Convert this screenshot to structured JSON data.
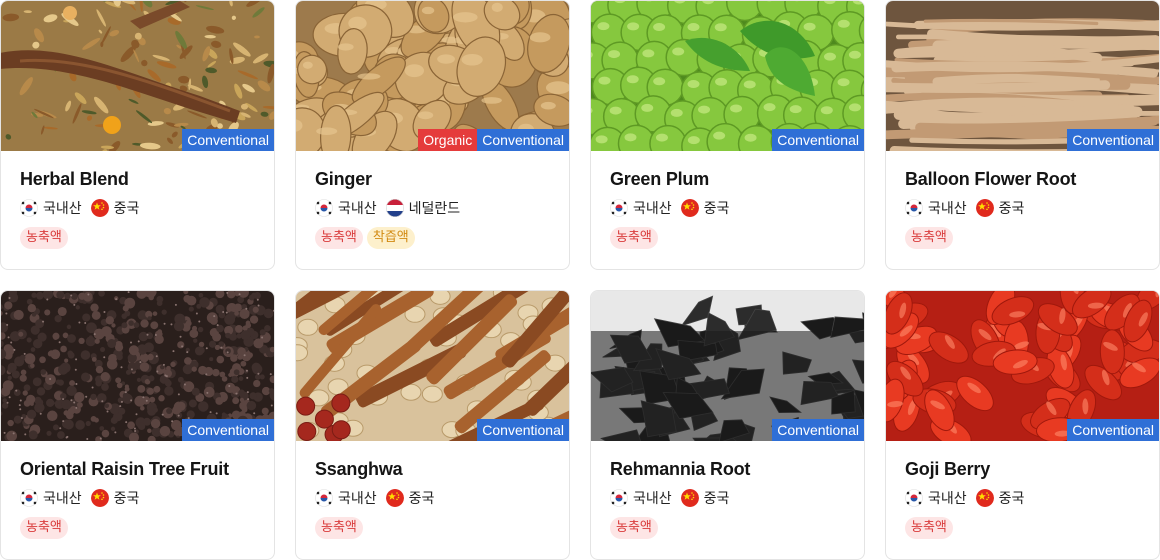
{
  "cards": [
    {
      "title": "Herbal Blend",
      "tags": [
        "Conventional"
      ],
      "origins": [
        "국내산",
        "중국"
      ],
      "badges": [
        "농축액"
      ],
      "image": "herbal-blend-photo",
      "colors": {
        "base": "#8a6a3a"
      }
    },
    {
      "title": "Ginger",
      "tags": [
        "Organic",
        "Conventional"
      ],
      "origins": [
        "국내산",
        "네덜란드"
      ],
      "badges": [
        "농축액",
        "착즙액"
      ],
      "image": "ginger-photo",
      "colors": {
        "base": "#c9a067"
      }
    },
    {
      "title": "Green Plum",
      "tags": [
        "Conventional"
      ],
      "origins": [
        "국내산",
        "중국"
      ],
      "badges": [
        "농축액"
      ],
      "image": "green-plum-photo",
      "colors": {
        "base": "#7ec23a"
      }
    },
    {
      "title": "Balloon Flower Root",
      "tags": [
        "Conventional"
      ],
      "origins": [
        "국내산",
        "중국"
      ],
      "badges": [
        "농축액"
      ],
      "image": "balloon-flower-root-photo",
      "colors": {
        "base": "#b89676"
      }
    },
    {
      "title": "Oriental Raisin Tree Fruit",
      "tags": [
        "Conventional"
      ],
      "origins": [
        "국내산",
        "중국"
      ],
      "badges": [
        "농축액"
      ],
      "image": "raisin-tree-fruit-photo",
      "colors": {
        "base": "#3e2f2c"
      }
    },
    {
      "title": "Ssanghwa",
      "tags": [
        "Conventional"
      ],
      "origins": [
        "국내산",
        "중국"
      ],
      "badges": [
        "농축액"
      ],
      "image": "ssanghwa-herbs-photo",
      "colors": {
        "base": "#a86a3a"
      }
    },
    {
      "title": "Rehmannia Root",
      "tags": [
        "Conventional"
      ],
      "origins": [
        "국내산",
        "중국"
      ],
      "badges": [
        "농축액"
      ],
      "image": "rehmannia-root-photo",
      "colors": {
        "base": "#1e1e1e"
      }
    },
    {
      "title": "Goji Berry",
      "tags": [
        "Conventional"
      ],
      "origins": [
        "국내산",
        "중국"
      ],
      "badges": [
        "농축액"
      ],
      "image": "goji-berry-photo",
      "colors": {
        "base": "#e0341f"
      }
    }
  ],
  "flag_icons": {
    "국내산": "korea-flag-icon",
    "중국": "china-flag-icon",
    "네덜란드": "netherlands-flag-icon"
  },
  "tag_colors": {
    "Conventional": "#2f6fd6",
    "Organic": "#e53b3b"
  },
  "badge_colors": {
    "농축액": "#d93b3b",
    "착즙액": "#d28a12"
  }
}
